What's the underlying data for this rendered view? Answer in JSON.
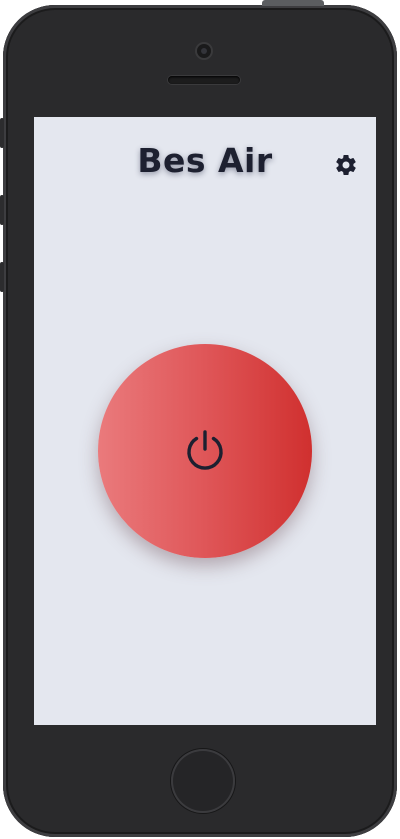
{
  "app": {
    "title": "Bes Air"
  },
  "header": {
    "settings_icon": "gear-icon"
  },
  "main": {
    "power_button_icon": "power-icon",
    "power_button_color_start": "#ea7a7c",
    "power_button_color_end": "#d0302f"
  },
  "colors": {
    "screen_background": "#e4e7ef",
    "title_text": "#1d2030",
    "phone_body": "#2a2a2c"
  }
}
